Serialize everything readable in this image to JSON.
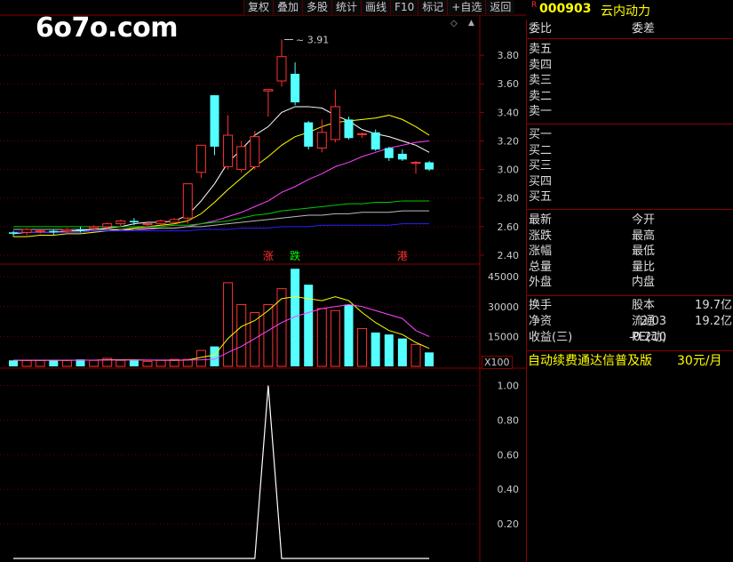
{
  "watermark": "6o7o.com",
  "toolbar": [
    "复权",
    "叠加",
    "多股",
    "统计",
    "画线",
    "F10",
    "标记",
    "+自选",
    "返回"
  ],
  "stock": {
    "marker": "R",
    "code": "000903",
    "name": "云内动力"
  },
  "panel": {
    "weibi_label": "委比",
    "weicha_label": "委差",
    "sell": [
      "卖五",
      "卖四",
      "卖三",
      "卖二",
      "卖一"
    ],
    "buy": [
      "买一",
      "买二",
      "买三",
      "买四",
      "买五"
    ],
    "stats_left": [
      "最新",
      "涨跌",
      "涨幅",
      "总量",
      "外盘"
    ],
    "stats_right": [
      "今开",
      "最高",
      "最低",
      "量比",
      "内盘"
    ],
    "fund": [
      {
        "l": "换手",
        "v": "",
        "l2": "股本",
        "v2": "19.7亿"
      },
      {
        "l": "净资",
        "v": "2.03",
        "l2": "流通",
        "v2": "19.2亿"
      },
      {
        "l": "收益(三)",
        "v": "-0.210",
        "l2": "PE(动)",
        "v2": ""
      }
    ],
    "ad_text": "自动续费通达信普及版",
    "ad_price": "30元/月"
  },
  "icons": {
    "diamond": "diamond-icon",
    "up": "up-arrow-icon"
  },
  "volume_unit": "X100",
  "chart_data": [
    {
      "type": "candlestick",
      "ylim": [
        2.35,
        4.0
      ],
      "yticks": [
        2.4,
        2.6,
        2.8,
        3.0,
        3.2,
        3.4,
        3.6,
        3.8
      ],
      "annotation": "3.91",
      "markers": [
        "涨",
        "跌",
        "港"
      ],
      "candles": [
        {
          "o": 2.56,
          "c": 2.55,
          "h": 2.57,
          "l": 2.53
        },
        {
          "o": 2.56,
          "c": 2.58,
          "h": 2.59,
          "l": 2.54
        },
        {
          "o": 2.57,
          "c": 2.57,
          "h": 2.58,
          "l": 2.55
        },
        {
          "o": 2.57,
          "c": 2.56,
          "h": 2.58,
          "l": 2.54
        },
        {
          "o": 2.57,
          "c": 2.58,
          "h": 2.59,
          "l": 2.55
        },
        {
          "o": 2.58,
          "c": 2.57,
          "h": 2.6,
          "l": 2.56
        },
        {
          "o": 2.59,
          "c": 2.6,
          "h": 2.61,
          "l": 2.57
        },
        {
          "o": 2.6,
          "c": 2.62,
          "h": 2.63,
          "l": 2.58
        },
        {
          "o": 2.62,
          "c": 2.64,
          "h": 2.65,
          "l": 2.6
        },
        {
          "o": 2.64,
          "c": 2.63,
          "h": 2.66,
          "l": 2.61
        },
        {
          "o": 2.62,
          "c": 2.62,
          "h": 2.63,
          "l": 2.6
        },
        {
          "o": 2.62,
          "c": 2.64,
          "h": 2.65,
          "l": 2.61
        },
        {
          "o": 2.63,
          "c": 2.65,
          "h": 2.66,
          "l": 2.62
        },
        {
          "o": 2.66,
          "c": 2.9,
          "h": 2.9,
          "l": 2.62
        },
        {
          "o": 2.98,
          "c": 3.17,
          "h": 3.17,
          "l": 2.94
        },
        {
          "o": 3.52,
          "c": 3.16,
          "h": 3.52,
          "l": 3.1
        },
        {
          "o": 3.02,
          "c": 3.24,
          "h": 3.38,
          "l": 3.0
        },
        {
          "o": 3.0,
          "c": 3.16,
          "h": 3.2,
          "l": 2.98
        },
        {
          "o": 3.02,
          "c": 3.23,
          "h": 3.27,
          "l": 3.0
        },
        {
          "o": 3.55,
          "c": 3.56,
          "h": 3.56,
          "l": 3.37
        },
        {
          "o": 3.62,
          "c": 3.79,
          "h": 3.91,
          "l": 3.58
        },
        {
          "o": 3.67,
          "c": 3.47,
          "h": 3.75,
          "l": 3.45
        },
        {
          "o": 3.33,
          "c": 3.16,
          "h": 3.34,
          "l": 3.14
        },
        {
          "o": 3.15,
          "c": 3.26,
          "h": 3.35,
          "l": 3.12
        },
        {
          "o": 3.21,
          "c": 3.44,
          "h": 3.56,
          "l": 3.19
        },
        {
          "o": 3.35,
          "c": 3.22,
          "h": 3.37,
          "l": 3.21
        },
        {
          "o": 3.25,
          "c": 3.25,
          "h": 3.26,
          "l": 3.22
        },
        {
          "o": 3.26,
          "c": 3.14,
          "h": 3.28,
          "l": 3.13
        },
        {
          "o": 3.15,
          "c": 3.08,
          "h": 3.16,
          "l": 3.06
        },
        {
          "o": 3.11,
          "c": 3.07,
          "h": 3.14,
          "l": 3.06
        },
        {
          "o": 3.05,
          "c": 3.05,
          "h": 3.06,
          "l": 2.97
        },
        {
          "o": 3.05,
          "c": 3.0,
          "h": 3.06,
          "l": 2.99
        }
      ],
      "ma": [
        {
          "color": "#ffffff",
          "values": [
            2.55,
            2.56,
            2.56,
            2.56,
            2.57,
            2.57,
            2.58,
            2.59,
            2.6,
            2.62,
            2.63,
            2.63,
            2.64,
            2.68,
            2.78,
            2.9,
            3.05,
            3.14,
            3.24,
            3.3,
            3.4,
            3.44,
            3.44,
            3.43,
            3.38,
            3.34,
            3.28,
            3.25,
            3.23,
            3.2,
            3.17,
            3.12
          ]
        },
        {
          "color": "#ffff00",
          "values": [
            2.53,
            2.53,
            2.54,
            2.54,
            2.55,
            2.55,
            2.56,
            2.57,
            2.58,
            2.59,
            2.6,
            2.61,
            2.62,
            2.64,
            2.69,
            2.77,
            2.86,
            2.94,
            3.02,
            3.09,
            3.17,
            3.23,
            3.26,
            3.3,
            3.33,
            3.34,
            3.35,
            3.36,
            3.38,
            3.35,
            3.3,
            3.24
          ]
        },
        {
          "color": "#ff44ff",
          "values": [
            2.56,
            2.56,
            2.56,
            2.56,
            2.56,
            2.56,
            2.57,
            2.57,
            2.57,
            2.58,
            2.58,
            2.59,
            2.59,
            2.6,
            2.62,
            2.64,
            2.67,
            2.7,
            2.74,
            2.78,
            2.84,
            2.88,
            2.93,
            2.97,
            3.02,
            3.05,
            3.09,
            3.12,
            3.15,
            3.17,
            3.19,
            3.2
          ]
        },
        {
          "color": "#00cc00",
          "values": [
            2.6,
            2.6,
            2.6,
            2.6,
            2.6,
            2.6,
            2.6,
            2.6,
            2.6,
            2.6,
            2.6,
            2.6,
            2.61,
            2.61,
            2.62,
            2.63,
            2.64,
            2.66,
            2.68,
            2.69,
            2.71,
            2.72,
            2.73,
            2.74,
            2.75,
            2.76,
            2.76,
            2.77,
            2.77,
            2.78,
            2.78,
            2.78
          ]
        },
        {
          "color": "#bbbbbb",
          "values": [
            2.58,
            2.58,
            2.58,
            2.58,
            2.58,
            2.58,
            2.58,
            2.58,
            2.58,
            2.58,
            2.59,
            2.59,
            2.59,
            2.6,
            2.6,
            2.61,
            2.62,
            2.63,
            2.64,
            2.65,
            2.66,
            2.67,
            2.68,
            2.68,
            2.69,
            2.69,
            2.7,
            2.7,
            2.7,
            2.71,
            2.71,
            2.71
          ]
        },
        {
          "color": "#2222ff",
          "values": [
            2.56,
            2.56,
            2.56,
            2.56,
            2.56,
            2.56,
            2.57,
            2.57,
            2.57,
            2.57,
            2.57,
            2.57,
            2.57,
            2.57,
            2.58,
            2.58,
            2.58,
            2.59,
            2.59,
            2.59,
            2.6,
            2.6,
            2.6,
            2.61,
            2.61,
            2.61,
            2.61,
            2.61,
            2.61,
            2.62,
            2.62,
            2.62
          ]
        }
      ]
    },
    {
      "type": "bar",
      "ylim": [
        0,
        50000
      ],
      "yticks": [
        15000,
        30000,
        45000
      ],
      "values": [
        3000,
        3000,
        3000,
        3000,
        3000,
        3500,
        3000,
        4000,
        3000,
        3000,
        2500,
        3000,
        3500,
        3500,
        8000,
        10000,
        42000,
        31000,
        27000,
        31000,
        39000,
        49000,
        41000,
        29000,
        28000,
        31000,
        19000,
        17000,
        16000,
        14000,
        11000,
        7000
      ],
      "ma": [
        {
          "color": "#ffff00",
          "values": [
            3000,
            3000,
            3000,
            3000,
            3000,
            3100,
            3100,
            3300,
            3300,
            3300,
            3100,
            3100,
            3000,
            3200,
            4500,
            5700,
            14000,
            20000,
            23000,
            28000,
            34000,
            35000,
            34000,
            33000,
            35000,
            33000,
            27000,
            22000,
            18000,
            16000,
            12000,
            9000
          ]
        },
        {
          "color": "#ff44ff",
          "values": [
            3100,
            3100,
            3100,
            3100,
            3100,
            3100,
            3100,
            3200,
            3200,
            3200,
            3200,
            3200,
            3200,
            3200,
            3300,
            3600,
            7000,
            10000,
            14000,
            18000,
            22000,
            25000,
            27000,
            29000,
            30000,
            31000,
            30000,
            28000,
            26000,
            24000,
            18000,
            15000
          ]
        }
      ]
    },
    {
      "type": "line",
      "ylim": [
        0,
        1.08
      ],
      "yticks": [
        0.2,
        0.4,
        0.6,
        0.8,
        1.0
      ],
      "values": [
        0,
        0,
        0,
        0,
        0,
        0,
        0,
        0,
        0,
        0,
        0,
        0,
        0,
        0,
        0,
        0,
        0,
        0,
        0,
        1,
        0,
        0,
        0,
        0,
        0,
        0,
        0,
        0,
        0,
        0,
        0,
        0
      ]
    }
  ]
}
